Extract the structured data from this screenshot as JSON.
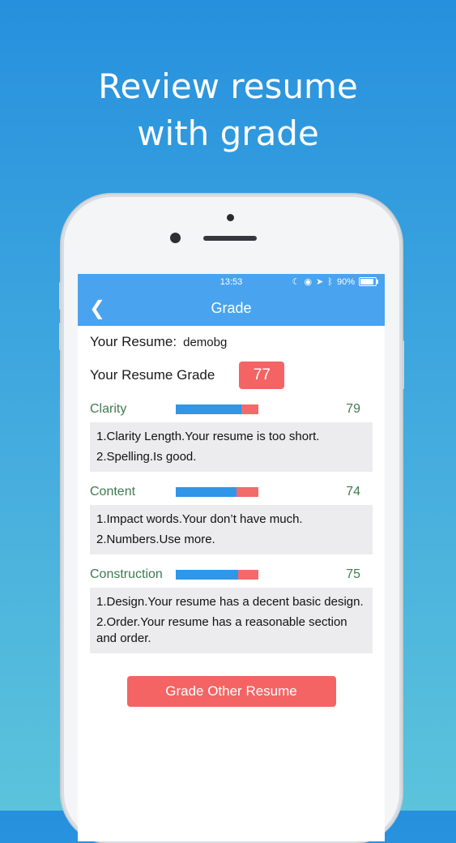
{
  "headline": {
    "line1": "Review resume",
    "line2": "with grade"
  },
  "status_bar": {
    "time": "13:53",
    "battery_text": "90%",
    "battery_level": 0.9
  },
  "nav": {
    "title": "Grade"
  },
  "resume": {
    "label": "Your Resume:",
    "name": "demobg"
  },
  "grade": {
    "label": "Your Resume Grade",
    "value": "77"
  },
  "sections": [
    {
      "name": "Clarity",
      "score": "79",
      "score_fraction": 0.79,
      "notes": [
        "1.Clarity Length.Your resume is too short.",
        "2.Spelling.Is good."
      ]
    },
    {
      "name": "Content",
      "score": "74",
      "score_fraction": 0.74,
      "notes": [
        "1.Impact words.Your don’t have much.",
        "2.Numbers.Use more."
      ]
    },
    {
      "name": "Construction",
      "score": "75",
      "score_fraction": 0.75,
      "notes": [
        "1.Design.Your resume has a decent basic design.",
        "2.Order.Your resume has a reasonable section and order."
      ]
    }
  ],
  "button": {
    "label": "Grade Other Resume"
  },
  "colors": {
    "accent_blue": "#4aa3ee",
    "grade_red": "#f46464",
    "section_green": "#3f7a51"
  }
}
